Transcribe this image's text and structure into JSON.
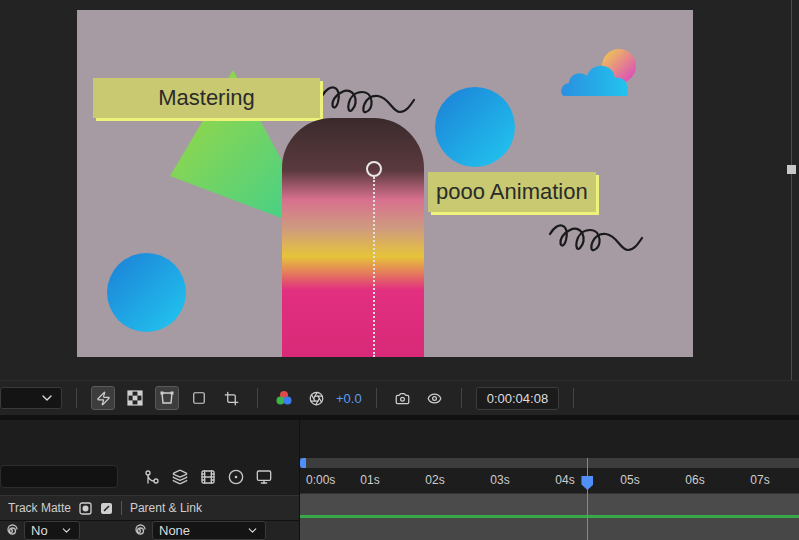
{
  "composition": {
    "labels": [
      {
        "text": "Mastering"
      },
      {
        "text": "pooo Animation"
      }
    ]
  },
  "viewer_toolbar": {
    "buttons": [
      {
        "selected": true
      },
      {
        "selected": false
      },
      {
        "selected": true
      },
      {
        "selected": false
      },
      {
        "selected": false
      }
    ],
    "exposure": "+0.0",
    "timecode": "0:00:04:08"
  },
  "timeline": {
    "ruler": [
      "0:00s",
      "01s",
      "02s",
      "03s",
      "04s",
      "05s",
      "06s",
      "07s"
    ],
    "playhead": {
      "level": 0.575
    },
    "columns": [
      "Track Matte",
      "Parent & Link"
    ],
    "layer": {
      "track_matte": "No",
      "parent": "None"
    }
  }
}
